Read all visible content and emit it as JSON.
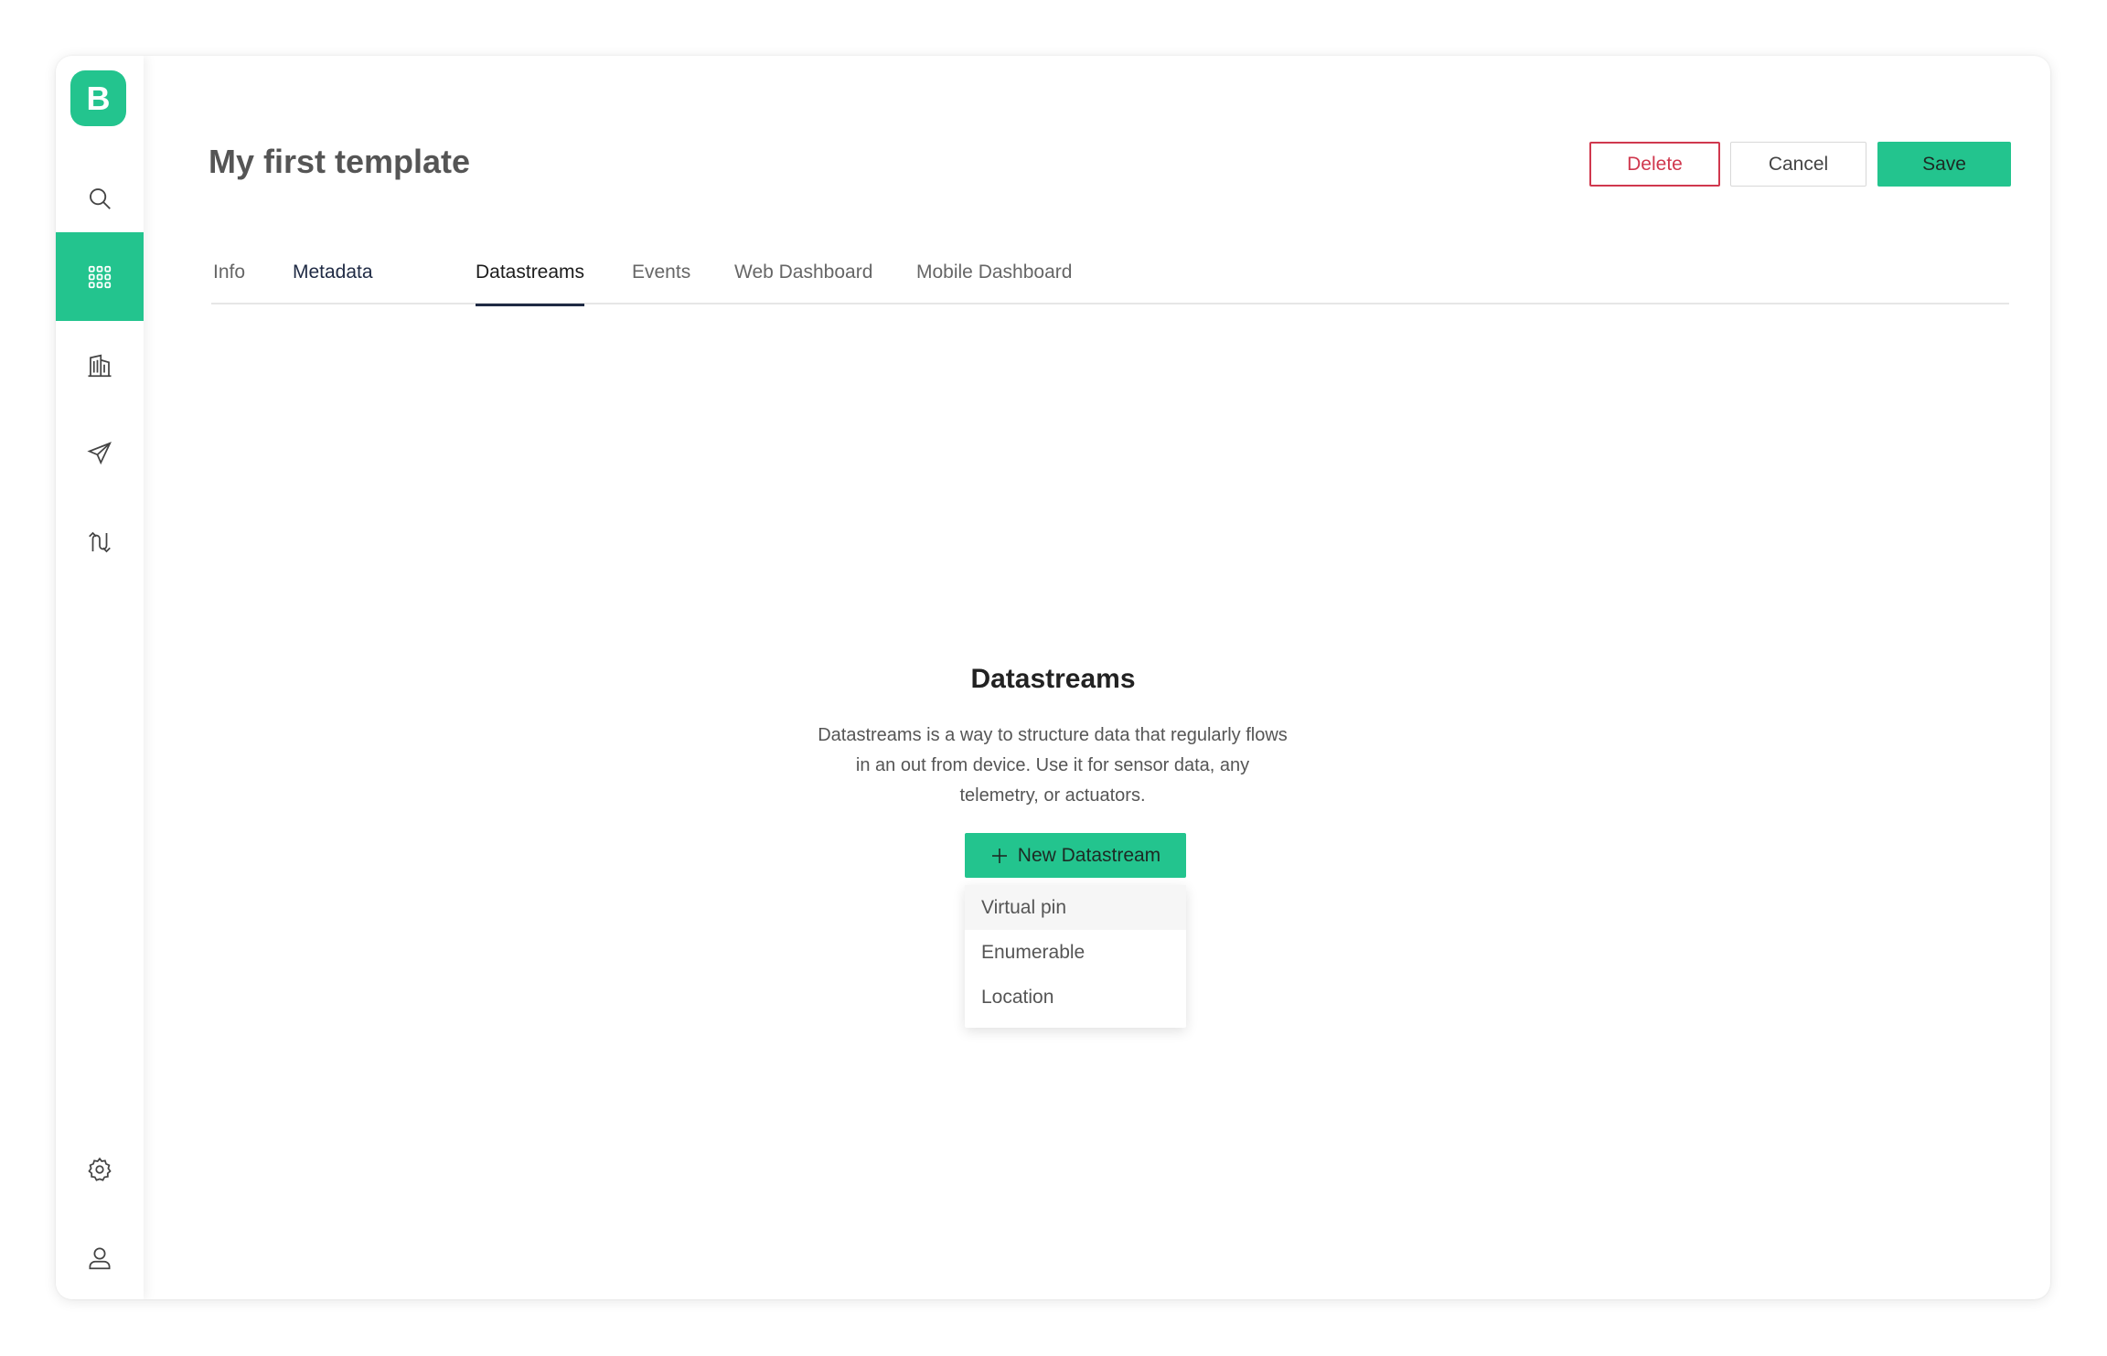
{
  "app": {
    "logo_letter": "B"
  },
  "sidebar": {
    "items": [
      {
        "icon": "search-icon"
      },
      {
        "icon": "grid-icon",
        "active": true
      },
      {
        "icon": "building-icon"
      },
      {
        "icon": "send-icon"
      },
      {
        "icon": "flow-icon"
      },
      {
        "icon": "gear-icon"
      },
      {
        "icon": "user-icon"
      }
    ]
  },
  "header": {
    "title": "My first template",
    "delete_label": "Delete",
    "cancel_label": "Cancel",
    "save_label": "Save"
  },
  "tabs": [
    "Info",
    "Metadata",
    "Datastreams",
    "Events",
    "Web Dashboard",
    "Mobile Dashboard"
  ],
  "active_tab": "Datastreams",
  "empty_state": {
    "title": "Datastreams",
    "line1": "Datastreams is a way to structure data that regularly flows",
    "line2": "in an out from device. Use it for sensor data, any",
    "line3": "telemetry, or actuators.",
    "button_label": "New Datastream"
  },
  "dropdown": {
    "items": [
      "Virtual pin",
      "Enumerable",
      "Location"
    ]
  },
  "colors": {
    "accent": "#23c48e",
    "danger": "#d0384e",
    "tab_active": "#1f2a44"
  }
}
